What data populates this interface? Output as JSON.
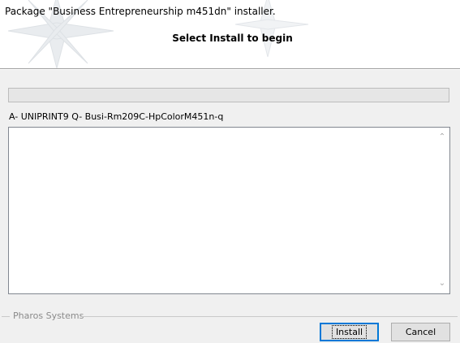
{
  "header": {
    "title": "Package \"Business Entrepreneurship m451dn\" installer.",
    "subtitle": "Select Install to begin"
  },
  "progress": {
    "value": 0
  },
  "status": {
    "text": "A- UNIPRINT9 Q- Busi-Rm209C-HpColorM451n-q"
  },
  "log": {
    "text": ""
  },
  "footer": {
    "brand": "Pharos Systems",
    "install_label": "Install",
    "cancel_label": "Cancel"
  },
  "colors": {
    "accent": "#0078d7",
    "background": "#f0f0f0"
  }
}
